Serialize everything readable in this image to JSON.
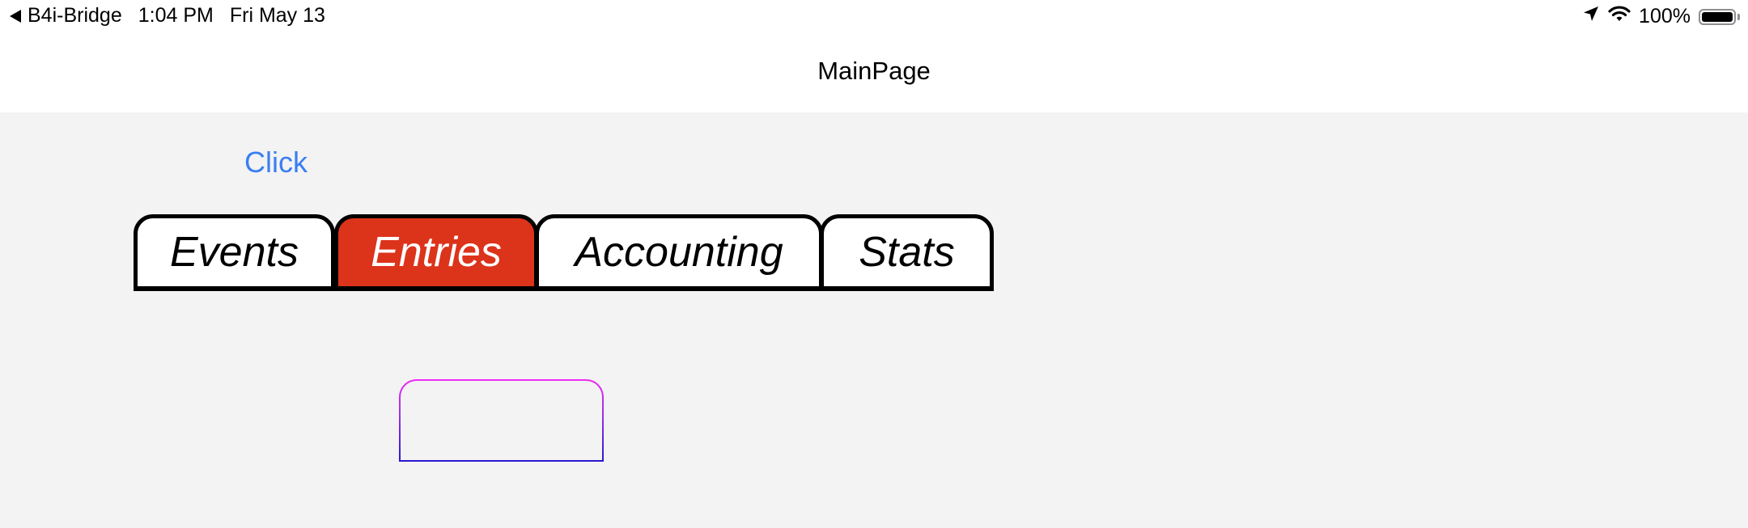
{
  "status_bar": {
    "back_app": "B4i-Bridge",
    "time": "1:04 PM",
    "date": "Fri May 13",
    "battery_percent": "100%",
    "battery_level": 1.0,
    "icons": [
      "location-arrow-icon",
      "wifi-icon",
      "battery-icon"
    ]
  },
  "nav": {
    "title": "MainPage"
  },
  "main": {
    "click_label": "Click",
    "tabs": [
      {
        "label": "Events",
        "active": false
      },
      {
        "label": "Entries",
        "active": true
      },
      {
        "label": "Accounting",
        "active": false
      },
      {
        "label": "Stats",
        "active": false
      }
    ]
  },
  "colors": {
    "link": "#3a7ff2",
    "active_tab": "#dc331b",
    "content_bg": "#f3f3f3",
    "gradient_top": "#f02cf5",
    "gradient_bottom": "#2818d0"
  }
}
